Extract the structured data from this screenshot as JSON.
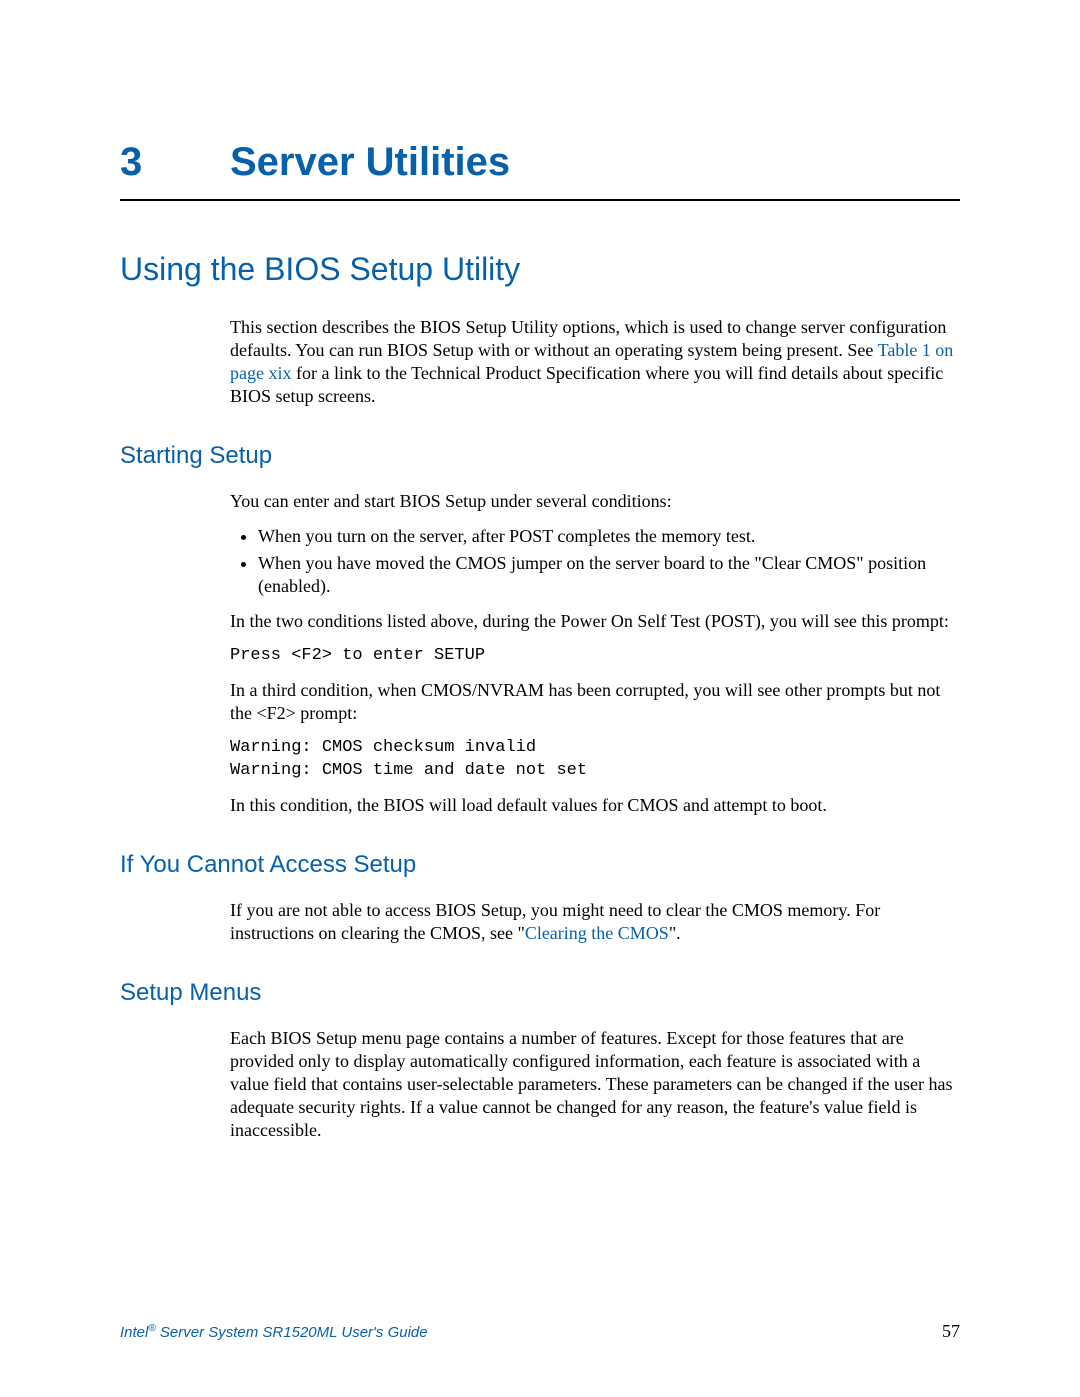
{
  "chapter": {
    "number": "3",
    "title": "Server Utilities"
  },
  "section1": {
    "heading": "Using the BIOS Setup Utility",
    "intro_a": "This section describes the BIOS Setup Utility options, which is used to change server configuration defaults. You can run BIOS Setup with or without an operating system being present. See ",
    "intro_link": "Table 1 on page xix",
    "intro_b": " for a link to the Technical Product Specification where you will find details about specific BIOS setup screens."
  },
  "starting": {
    "heading": "Starting Setup",
    "p1": "You can enter and start BIOS Setup under several conditions:",
    "bullets": [
      "When you turn on the server, after POST completes the memory test.",
      "When you have moved the CMOS jumper on the server board to the \"Clear CMOS\" position (enabled)."
    ],
    "p2": "In the two conditions listed above, during the Power On Self Test (POST), you will see this prompt:",
    "code1": "Press <F2> to enter SETUP",
    "p3": "In a third condition, when CMOS/NVRAM has been corrupted, you will see other prompts but not the <F2> prompt:",
    "code2": "Warning: CMOS checksum invalid\nWarning: CMOS time and date not set",
    "p4": "In this condition, the BIOS will load default values for CMOS and attempt to boot."
  },
  "cannot": {
    "heading": "If You Cannot Access Setup",
    "p1a": "If you are not able to access BIOS Setup, you might need to clear the CMOS memory. For instructions on clearing the CMOS, see \"",
    "link": "Clearing the CMOS",
    "p1b": "\"."
  },
  "menus": {
    "heading": "Setup Menus",
    "p1": "Each BIOS Setup menu page contains a number of features. Except for those features that are provided only to display automatically configured information, each feature is associated with a value field that contains user-selectable parameters. These parameters can be changed if the user has adequate security rights. If a value cannot be changed for any reason, the feature's value field is inaccessible."
  },
  "footer": {
    "brand_a": "Intel",
    "brand_sup": "®",
    "brand_b": " Server System SR1520ML User's Guide",
    "page": "57"
  }
}
